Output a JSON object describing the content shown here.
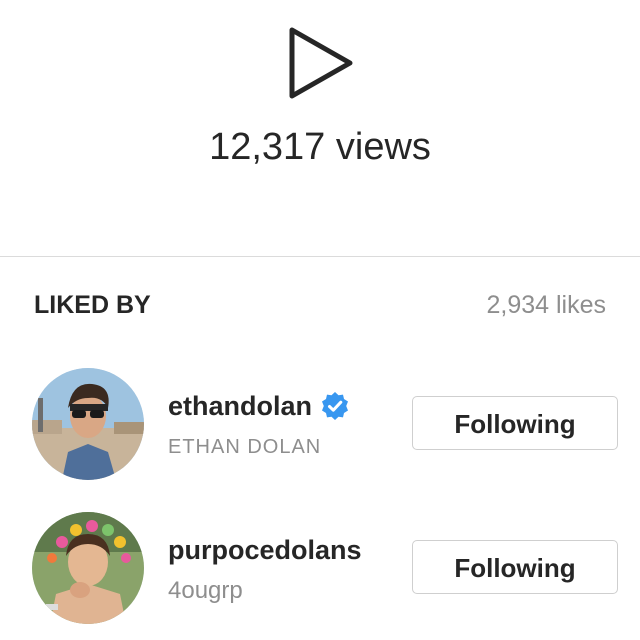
{
  "video": {
    "play_icon": "play-triangle-outline-icon",
    "views_text": "12,317 views"
  },
  "liked_by": {
    "header": "LIKED BY",
    "likes_text": "2,934 likes",
    "users": [
      {
        "username": "ethandolan",
        "verified": true,
        "verified_icon": "verified-badge-icon",
        "subtitle": "ETHAN DOLAN",
        "button_label": "Following"
      },
      {
        "username": "purpocedolans",
        "verified": false,
        "subtitle": "4ougrp",
        "button_label": "Following"
      }
    ]
  },
  "colors": {
    "text_primary": "#262626",
    "text_secondary": "#8e8e8e",
    "divider": "#dbdbdb",
    "verified_blue": "#3897f0"
  }
}
